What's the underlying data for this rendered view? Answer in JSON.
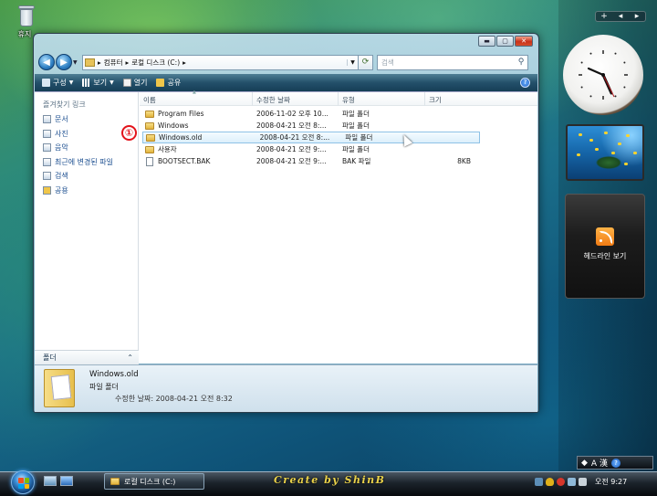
{
  "desktop": {
    "recycle_bin_label": "휴지",
    "sidebar": {
      "controls": [
        "+",
        "◂",
        "▸"
      ],
      "feed_label": "헤드라인 보기"
    }
  },
  "window": {
    "address": {
      "segments": [
        "컴퓨터",
        "로컬 디스크 (C:)"
      ]
    },
    "search_placeholder": "검색",
    "toolbar": {
      "organize": "구성",
      "views": "보기",
      "open": "열기",
      "share": "공유"
    },
    "nav_pane": {
      "header": "즐겨찾기 링크",
      "links": [
        {
          "label": "문서",
          "icon": "documents-icon"
        },
        {
          "label": "사진",
          "icon": "pictures-icon"
        },
        {
          "label": "음악",
          "icon": "music-icon"
        },
        {
          "label": "최근에 변경된 파일",
          "icon": "recent-icon"
        },
        {
          "label": "검색",
          "icon": "search-icon"
        },
        {
          "label": "공용",
          "icon": "public-icon"
        }
      ],
      "folders_label": "폴더"
    },
    "columns": {
      "name": "이름",
      "date": "수정한 날짜",
      "type": "유형",
      "size": "크기"
    },
    "files": [
      {
        "name": "Program Files",
        "date": "2006-11-02 오후 10...",
        "type": "파일 폴더",
        "size": "",
        "icon": "folder-icon"
      },
      {
        "name": "Windows",
        "date": "2008-04-21 오전 8:...",
        "type": "파일 폴더",
        "size": "",
        "icon": "folder-icon"
      },
      {
        "name": "Windows.old",
        "date": "2008-04-21 오전 8:...",
        "type": "파일 폴더",
        "size": "",
        "icon": "folder-icon",
        "selected": true
      },
      {
        "name": "사용자",
        "date": "2008-04-21 오전 9:...",
        "type": "파일 폴더",
        "size": "",
        "icon": "folder-icon"
      },
      {
        "name": "BOOTSECT.BAK",
        "date": "2008-04-21 오전 9:...",
        "type": "BAK 파일",
        "size": "8KB",
        "icon": "file-icon"
      }
    ],
    "annotation_marker": "①",
    "details": {
      "name": "Windows.old",
      "type": "파일 폴더",
      "modified": "수정한 날짜: 2008-04-21 오전 8:32"
    }
  },
  "taskbar": {
    "task_button": "로컬 디스크 (C:)",
    "credit": "Create by ShinB",
    "clock": "오전 9:27",
    "language_bar": "A 漢"
  }
}
